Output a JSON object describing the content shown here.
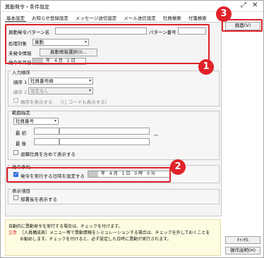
{
  "window": {
    "title": "異動発令・条件設定"
  },
  "tabs": [
    "基本設定",
    "お知らせ登録設定",
    "メッセージ送信設定",
    "メール送信設定",
    "社員検索",
    "付箋検索"
  ],
  "basic": {
    "pattern_name_label": "異動発令パターン名",
    "pattern_no_label": "パターン番号",
    "target_label": "処理対象",
    "target_value": "異動",
    "unsent_label": "未発令情報",
    "unsent_button": "異動情報選択(I)...",
    "date_label": "発令年月日",
    "date_year": "",
    "date_text": "年　4 月　1 日"
  },
  "input_order": {
    "title": "入力順序",
    "order1_label": "順序 1",
    "order1_value": "社員番号順",
    "order2_label": "順序 2",
    "order2_value": "設定なし",
    "show_order_label": "順序を表示する",
    "show_code_label": "（□ コードも表示する）"
  },
  "range": {
    "title": "範囲指定",
    "field_value": "社員番号",
    "first_label": "最 初",
    "last_label": "最 後",
    "tilde": "～",
    "retired_label": "退職社員を含めて表示する"
  },
  "schedule": {
    "title": "発令予約",
    "set_label": "発令を実行する日時を設定する",
    "datetime_text": "年　4 月　1 日　0 時　0 分"
  },
  "display": {
    "title": "表示項目",
    "dept_head_label": "部署長を表示する"
  },
  "buttons": {
    "screen": "画面(V)",
    "cancel": "ｷｬﾝｾﾙ",
    "help": "操作説明(H)"
  },
  "bottom": {
    "line1": "自動的に異動発令を実行する場合は、チェックを付けます。",
    "note_label": "注意",
    "line2": "［人員構成表］メニュー等で異動情報をシミュレーションする場合は、チェックを外しておくことを",
    "line3": "お勧めします。チェックを付けると、必ず設定した日時に異動が実行されます。"
  },
  "callouts": [
    "1",
    "2",
    "3"
  ],
  "colors": {
    "callout": "#e0222a",
    "checkbox": "#2d6ae3",
    "note": "#e0222a",
    "bottom_bg": "#fdfbe0"
  }
}
